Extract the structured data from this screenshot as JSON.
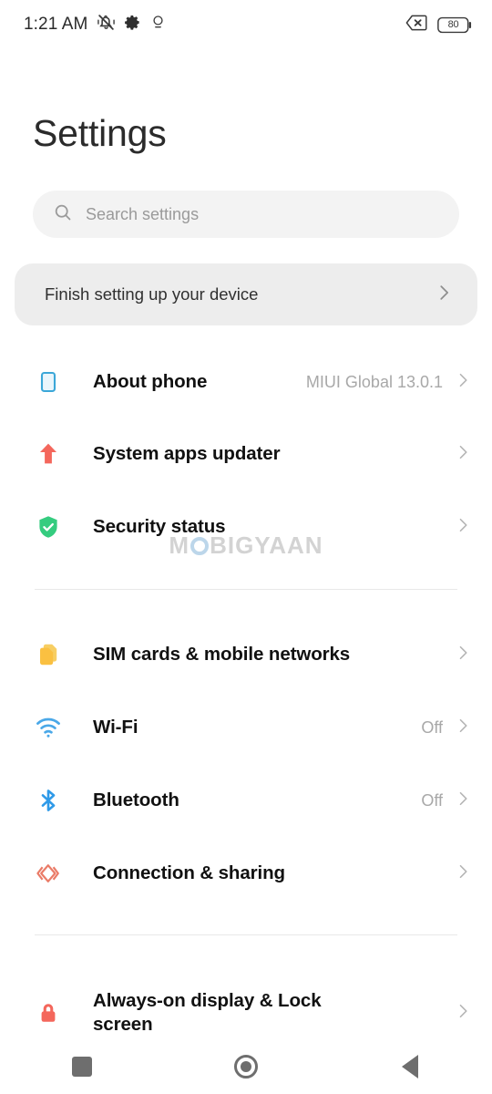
{
  "status_bar": {
    "time": "1:21 AM",
    "left_icons": [
      "vibrate-mute-icon",
      "gear-icon",
      "location-search-icon"
    ],
    "right_icons": [
      "no-sim-icon",
      "battery-icon"
    ],
    "battery_level": "80"
  },
  "header": {
    "title": "Settings"
  },
  "search": {
    "placeholder": "Search settings",
    "value": "",
    "icon": "search-icon"
  },
  "banner": {
    "label": "Finish setting up your device",
    "chevron": "chevron-right-icon"
  },
  "groups": [
    {
      "items": [
        {
          "icon": "phone-outline-icon",
          "label": "About phone",
          "value": "MIUI Global 13.0.1",
          "color": "#3ba7d8"
        },
        {
          "icon": "up-arrow-icon",
          "label": "System apps updater",
          "value": "",
          "color": "#f4675c"
        },
        {
          "icon": "shield-check-icon",
          "label": "Security status",
          "value": "",
          "color": "#35cc7f"
        }
      ]
    },
    {
      "items": [
        {
          "icon": "sim-cards-icon",
          "label": "SIM cards & mobile networks",
          "value": "",
          "color": "#fac041"
        },
        {
          "icon": "wifi-icon",
          "label": "Wi-Fi",
          "value": "Off",
          "color": "#4aa8e8"
        },
        {
          "icon": "bluetooth-icon",
          "label": "Bluetooth",
          "value": "Off",
          "color": "#2f9ae8"
        },
        {
          "icon": "connection-sharing-icon",
          "label": "Connection & sharing",
          "value": "",
          "color": "#ea7b67"
        }
      ]
    },
    {
      "items": [
        {
          "icon": "lock-icon",
          "label": "Always-on display & Lock screen",
          "value": "",
          "color": "#f4675c"
        }
      ]
    }
  ],
  "watermark": {
    "prefix": "M",
    "suffix": "BIGYAAN"
  },
  "nav_bar": {
    "recents": "recents-square-icon",
    "home": "home-circle-icon",
    "back": "back-triangle-icon"
  },
  "colors": {
    "background": "#ffffff",
    "search_bg": "#f3f3f3",
    "banner_bg": "#ededed",
    "label": "#111111",
    "muted": "#a8a8a8",
    "divider": "#e9e9e9"
  }
}
